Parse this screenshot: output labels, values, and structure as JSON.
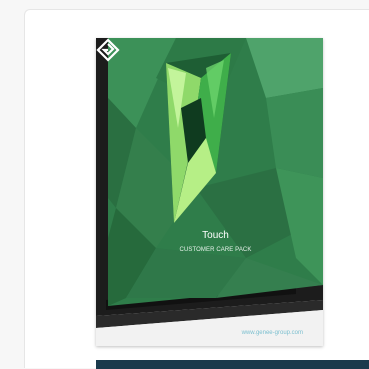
{
  "brochure": {
    "product_name": "Touch",
    "subtitle": "CUSTOMER CARE PACK",
    "website": "www.genee-group.com",
    "logo_icon": "genee-logo-icon"
  },
  "colors": {
    "screen_green": "#2e8b4f",
    "bezel": "#1a1a1a",
    "footer_bar": "#1b3a4c",
    "link": "#7bbfcf"
  }
}
